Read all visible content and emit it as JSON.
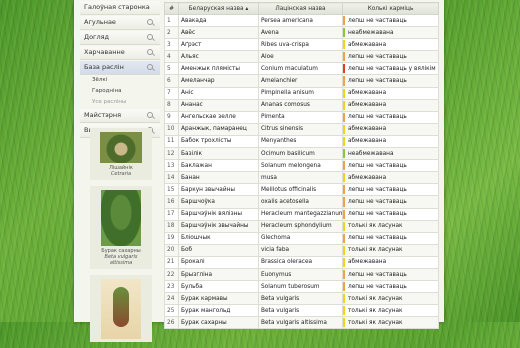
{
  "colors": {
    "orange": "#f0a24a",
    "green": "#8cc63f",
    "red": "#e23a2a",
    "yellow": "#f2d21a"
  },
  "sidebar": {
    "items": [
      {
        "label": "Галоўная старонка",
        "search": false
      },
      {
        "label": "Агульнае",
        "search": true
      },
      {
        "label": "Догляд",
        "search": true
      },
      {
        "label": "Харчаванне",
        "search": true
      },
      {
        "label": "База раслін",
        "search": true,
        "active": true
      },
      {
        "label": "Майстэрня",
        "search": true
      },
      {
        "label": "Выхаванне",
        "search": true
      }
    ],
    "submenu": [
      "Зёлкі",
      "Гародніна",
      "Усе расліны"
    ],
    "thumbs": [
      {
        "name": "Лішайнік",
        "latin": "Cetraria"
      },
      {
        "name": "Бурак сахарны",
        "latin": "Beta vulgaris altissima"
      },
      {
        "name": "",
        "latin": ""
      }
    ]
  },
  "table": {
    "headers": [
      "#",
      "Беларуская назва ▴",
      "Лацінская назва",
      "Колькі карміць"
    ],
    "rows": [
      {
        "n": "1",
        "be": "Авакада",
        "la": "Persea americana",
        "st": "лепш не частаваць",
        "c": "orange"
      },
      {
        "n": "2",
        "be": "Авёс",
        "la": "Avena",
        "st": "неабмежавана",
        "c": "green"
      },
      {
        "n": "3",
        "be": "Аґрэст",
        "la": "Ribes uva-crispa",
        "st": "абмежавана",
        "c": "yellow"
      },
      {
        "n": "4",
        "be": "Альяс",
        "la": "Aloe",
        "st": "лепш не частаваць",
        "c": "orange"
      },
      {
        "n": "5",
        "be": "Аменжык плямісты",
        "la": "Conium maculatum",
        "st": "лепш не частаваць у вялікім разе",
        "c": "red"
      },
      {
        "n": "6",
        "be": "Амеланчар",
        "la": "Amelanchier",
        "st": "лепш не частаваць",
        "c": "orange"
      },
      {
        "n": "7",
        "be": "Аніс",
        "la": "Pimpinella anisum",
        "st": "абмежавана",
        "c": "yellow"
      },
      {
        "n": "8",
        "be": "Ананас",
        "la": "Ananas comosus",
        "st": "абмежавана",
        "c": "yellow"
      },
      {
        "n": "9",
        "be": "Ангельскае зелле",
        "la": "Pimenta",
        "st": "лепш не частаваць",
        "c": "orange"
      },
      {
        "n": "10",
        "be": "Аранжык, памаранец",
        "la": "Citrus sinensis",
        "st": "абмежавана",
        "c": "yellow"
      },
      {
        "n": "11",
        "be": "Бабок трохлісты",
        "la": "Menyanthes",
        "st": "абмежавана",
        "c": "yellow"
      },
      {
        "n": "12",
        "be": "Базілік",
        "la": "Ocimum basilicum",
        "st": "неабмежавана",
        "c": "green"
      },
      {
        "n": "13",
        "be": "Баклажан",
        "la": "Solanum melongena",
        "st": "лепш не частаваць",
        "c": "orange"
      },
      {
        "n": "14",
        "be": "Банан",
        "la": "musa",
        "st": "абмежавана",
        "c": "yellow"
      },
      {
        "n": "15",
        "be": "Баркун звычайны",
        "la": "Melilotus officinalis",
        "st": "лепш не частаваць",
        "c": "orange"
      },
      {
        "n": "16",
        "be": "Баршчоўка",
        "la": "oxalis acetosella",
        "st": "лепш не частаваць",
        "c": "orange"
      },
      {
        "n": "17",
        "be": "Баршчэўнік вялізны",
        "la": "Heracleum mantegazzianum",
        "st": "лепш не частаваць",
        "c": "orange"
      },
      {
        "n": "18",
        "be": "Баршчэўнік звычайны",
        "la": "Heracleum sphondylium",
        "st": "толькі як ласунак",
        "c": "yellow"
      },
      {
        "n": "19",
        "be": "Бліошчык",
        "la": "Glechoma",
        "st": "лепш не частаваць",
        "c": "orange"
      },
      {
        "n": "20",
        "be": "Боб",
        "la": "vicia faba",
        "st": "толькі як ласунак",
        "c": "yellow"
      },
      {
        "n": "21",
        "be": "Брокалі",
        "la": "Brassica oleracea",
        "st": "абмежавана",
        "c": "yellow"
      },
      {
        "n": "22",
        "be": "Брызгліна",
        "la": "Euonymus",
        "st": "лепш не частаваць",
        "c": "orange"
      },
      {
        "n": "23",
        "be": "Бульба",
        "la": "Solanum tuberosum",
        "st": "лепш не частаваць",
        "c": "orange"
      },
      {
        "n": "24",
        "be": "Бурак кармавы",
        "la": "Beta vulgaris",
        "st": "толькі як ласунак",
        "c": "yellow"
      },
      {
        "n": "25",
        "be": "Бурак мангольд",
        "la": "Beta vulgaris",
        "st": "толькі як ласунак",
        "c": "yellow"
      },
      {
        "n": "26",
        "be": "Бурак сахарны",
        "la": "Beta vulgaris altissima",
        "st": "толькі як ласунак",
        "c": "yellow"
      }
    ]
  }
}
